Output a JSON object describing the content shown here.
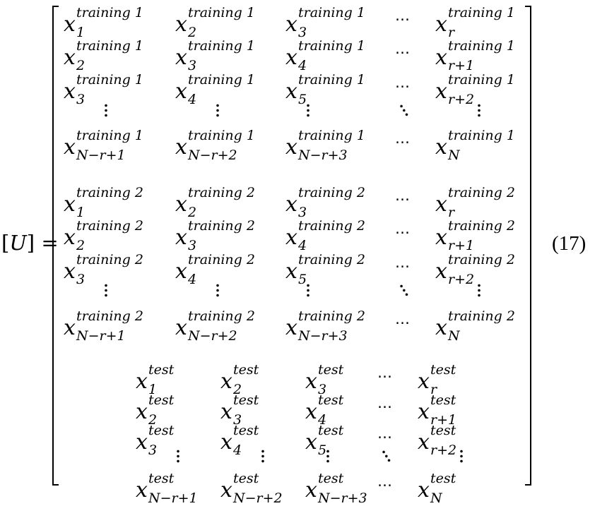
{
  "equation": {
    "lhs": {
      "open": "[",
      "symbol": "U",
      "close": "]",
      "equals": "="
    },
    "number": "(17)",
    "blocks": [
      {
        "variable": "x",
        "superscript": "training 1",
        "rows": [
          {
            "type": "entries",
            "subscripts": [
              "1",
              "2",
              "3",
              "…",
              "r"
            ]
          },
          {
            "type": "entries",
            "subscripts": [
              "2",
              "3",
              "4",
              "…",
              "r+1"
            ]
          },
          {
            "type": "entries",
            "subscripts": [
              "3",
              "4",
              "5",
              "…",
              "r+2"
            ]
          },
          {
            "type": "dots"
          },
          {
            "type": "entries",
            "subscripts": [
              "N−r+1",
              "N−r+2",
              "N−r+3",
              "…",
              "N"
            ]
          }
        ]
      },
      {
        "variable": "x",
        "superscript": "training 2",
        "rows": [
          {
            "type": "entries",
            "subscripts": [
              "1",
              "2",
              "3",
              "…",
              "r"
            ]
          },
          {
            "type": "entries",
            "subscripts": [
              "2",
              "3",
              "4",
              "…",
              "r+1"
            ]
          },
          {
            "type": "entries",
            "subscripts": [
              "3",
              "4",
              "5",
              "…",
              "r+2"
            ]
          },
          {
            "type": "dots"
          },
          {
            "type": "entries",
            "subscripts": [
              "N−r+1",
              "N−r+2",
              "N−r+3",
              "…",
              "N"
            ]
          }
        ]
      },
      {
        "variable": "x",
        "superscript": "test",
        "rows": [
          {
            "type": "entries",
            "subscripts": [
              "1",
              "2",
              "3",
              "…",
              "r"
            ]
          },
          {
            "type": "entries",
            "subscripts": [
              "2",
              "3",
              "4",
              "…",
              "r+1"
            ]
          },
          {
            "type": "entries",
            "subscripts": [
              "3",
              "4",
              "5",
              "…",
              "r+2"
            ]
          },
          {
            "type": "dots"
          },
          {
            "type": "entries",
            "subscripts": [
              "N−r+1",
              "N−r+2",
              "N−r+3",
              "…",
              "N"
            ]
          }
        ]
      }
    ]
  }
}
